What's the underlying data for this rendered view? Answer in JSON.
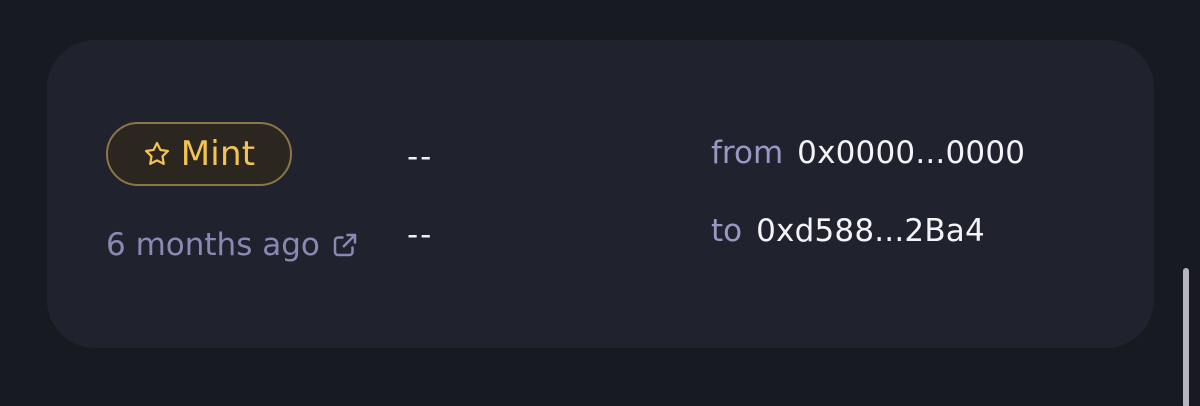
{
  "transaction": {
    "type_label": "Mint",
    "type_icon": "star-icon",
    "time_ago": "6 months ago",
    "external_link_icon": "external-link-icon",
    "value_1": "--",
    "value_2": "--",
    "from_label": "from",
    "from_address": "0x0000...0000",
    "to_label": "to",
    "to_address": "0xd588...2Ba4"
  },
  "colors": {
    "page_background": "#181a21",
    "card_background": "#20232e",
    "badge_border": "#8a7646",
    "badge_text": "#f3c451",
    "muted_text": "#8c88b4",
    "primary_text": "#f4f4f8"
  }
}
